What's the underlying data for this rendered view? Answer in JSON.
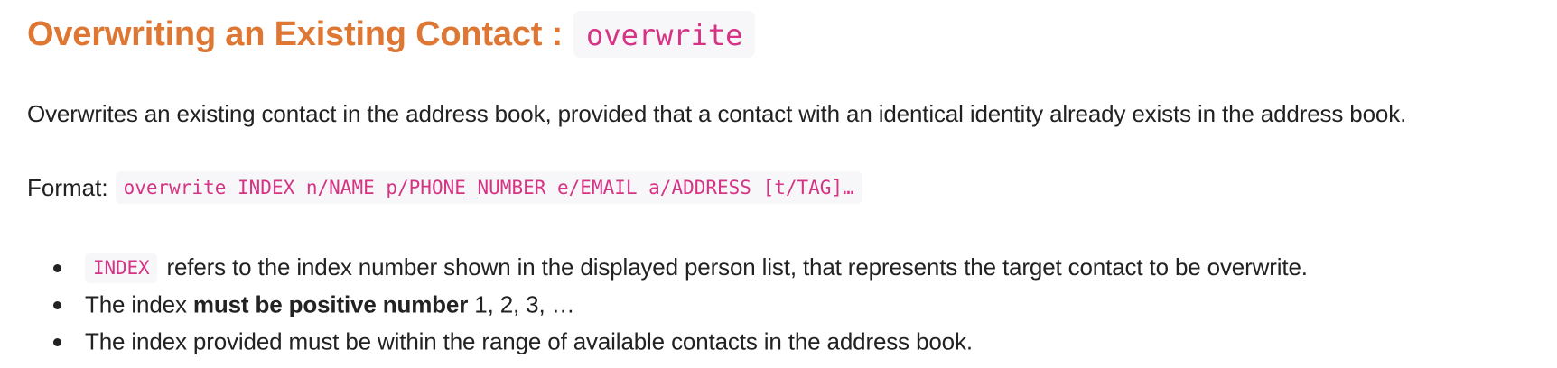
{
  "heading": {
    "text": "Overwriting an Existing Contact :",
    "code": "overwrite"
  },
  "description": "Overwrites an existing contact in the address book, provided that a contact with an identical identity already exists in the address book.",
  "format": {
    "label": "Format:",
    "code": "overwrite INDEX n/NAME p/PHONE_NUMBER e/EMAIL a/ADDRESS [t/TAG]…"
  },
  "bullets": [
    {
      "code": "INDEX",
      "text": "refers to the index number shown in the displayed person list, that represents the target contact to be overwrite."
    },
    {
      "prefix": "The index ",
      "bold": "must be positive number",
      "suffix": " 1, 2, 3, …"
    },
    {
      "text": "The index provided must be within the range of available contacts in the address book."
    }
  ],
  "colors": {
    "heading": "#dd7733",
    "code_text": "#d63384",
    "code_background": "#f7f7f9",
    "body_text": "#222222"
  }
}
